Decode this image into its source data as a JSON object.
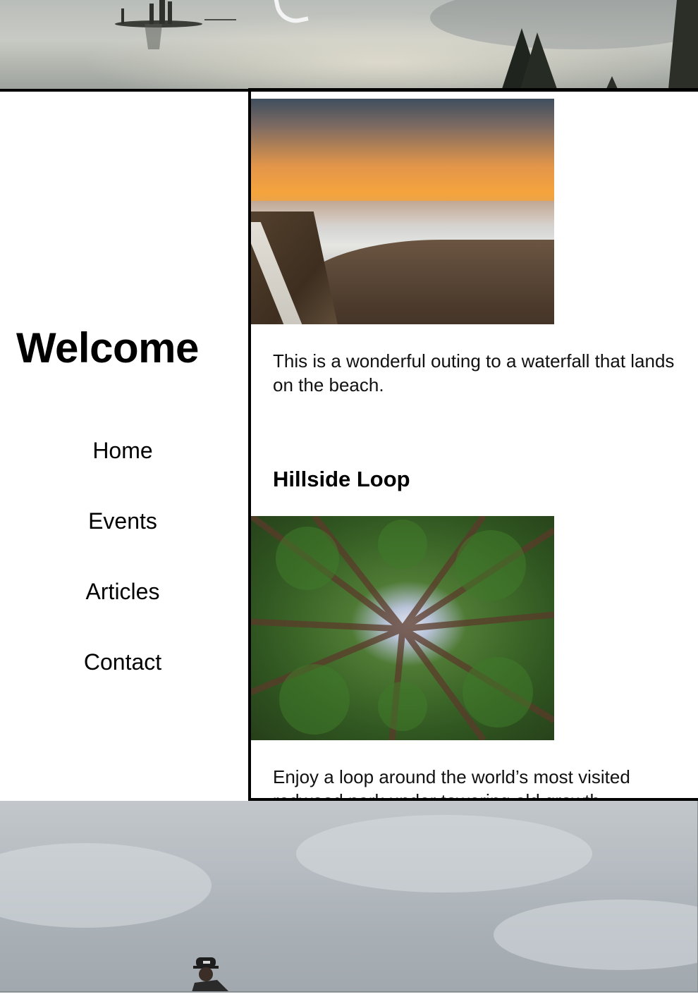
{
  "sidebar": {
    "title": "Welcome",
    "nav": [
      "Home",
      "Events",
      "Articles",
      "Contact"
    ]
  },
  "main": {
    "posts": [
      {
        "image": "sunset-beach-waterfall-photo",
        "caption": "This is a wonderful outing to a waterfall that lands on the beach."
      },
      {
        "title": "Hillside Loop",
        "image": "redwood-canopy-photo",
        "caption": "Enjoy a loop around the world’s most visited redwood park under towering old growth"
      }
    ]
  },
  "banners": {
    "top": "lake-island-banner-photo",
    "bottom": "cloudy-sky-hiker-banner-photo"
  }
}
